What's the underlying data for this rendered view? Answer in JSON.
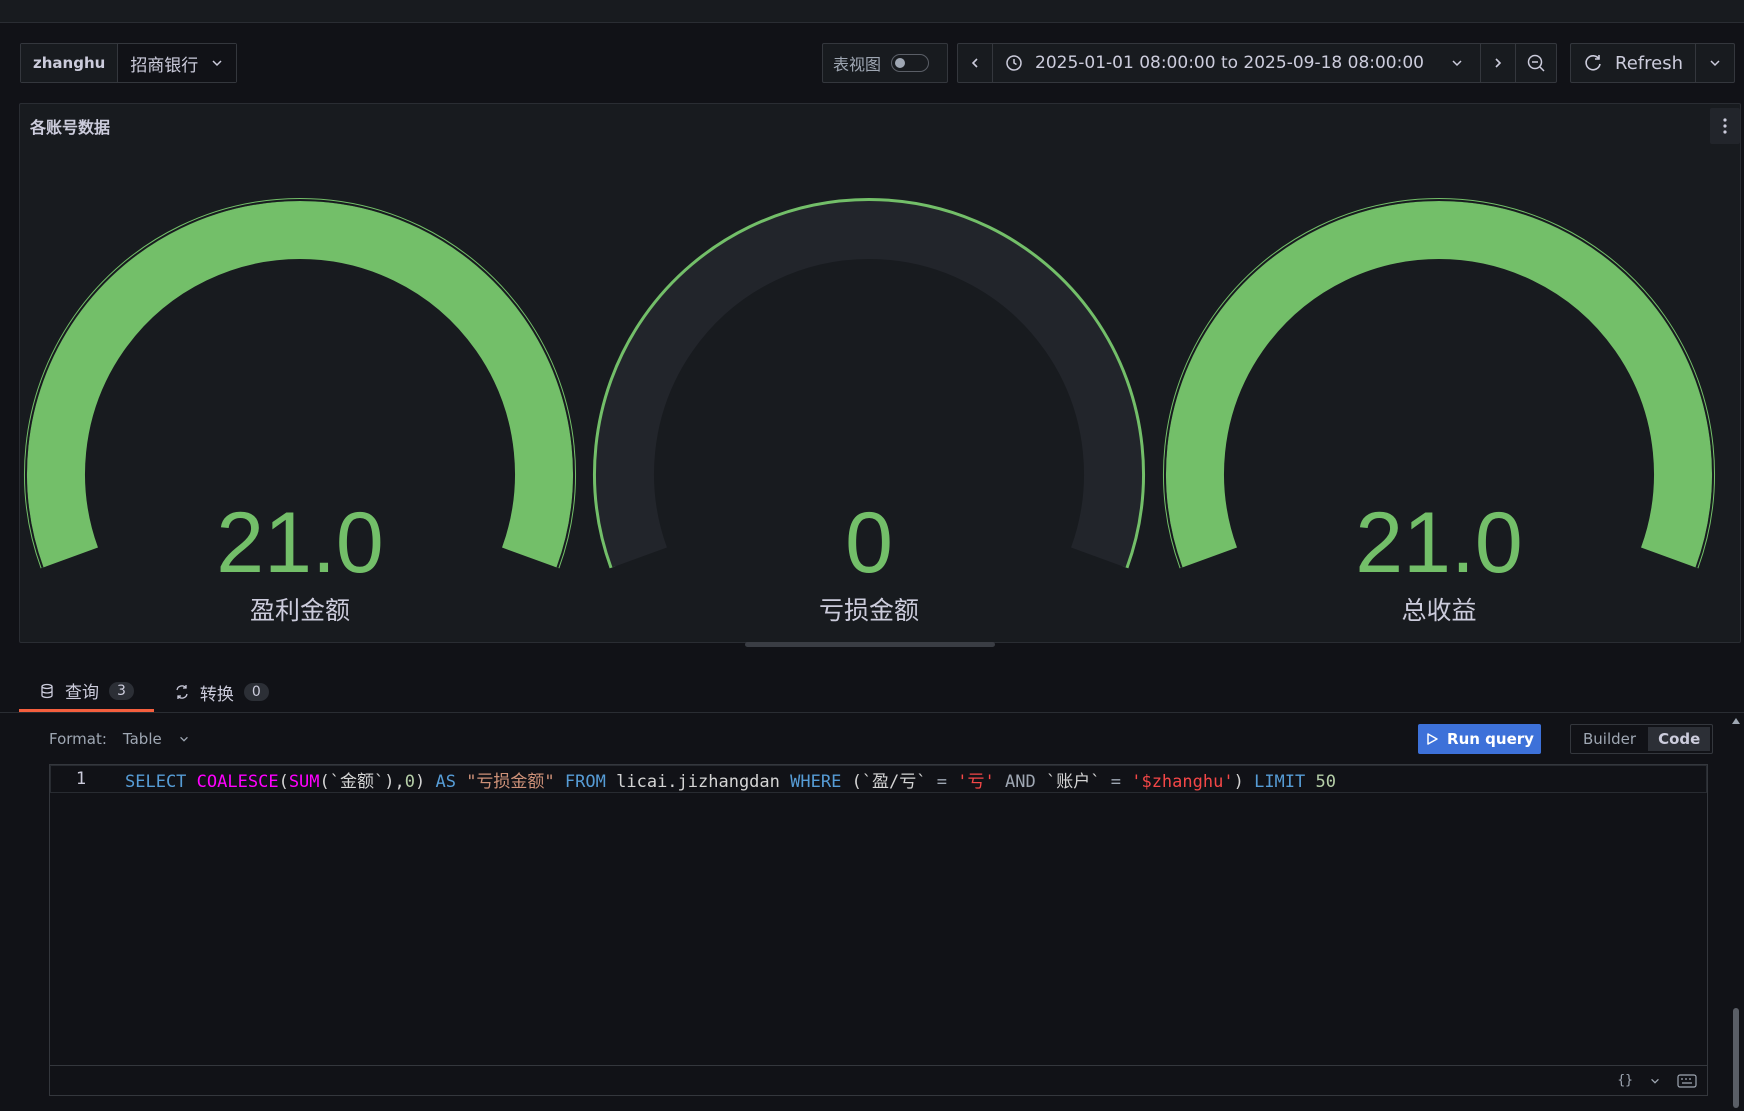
{
  "variables": {
    "label": "zhanghu",
    "value": "招商银行"
  },
  "toolbar": {
    "table_view_label": "表视图",
    "time_range": "2025-01-01 08:00:00 to 2025-09-18 08:00:00",
    "refresh_label": "Refresh"
  },
  "panel": {
    "title": "各账号数据",
    "gauges": [
      {
        "label": "盈利金额",
        "display": "21.0",
        "value": 21.0,
        "fill_fraction": 1.0
      },
      {
        "label": "亏损金额",
        "display": "0",
        "value": 0,
        "fill_fraction": 0.0
      },
      {
        "label": "总收益",
        "display": "21.0",
        "value": 21.0,
        "fill_fraction": 1.0
      }
    ]
  },
  "colors": {
    "gauge_green": "#73bf69",
    "gauge_track": "#22252b",
    "run_button": "#3d71d9",
    "active_tab": "#f55f3e"
  },
  "tabs": [
    {
      "label": "查询",
      "count": "3"
    },
    {
      "label": "转换",
      "count": "0"
    }
  ],
  "query": {
    "format_label": "Format:",
    "format_value": "Table",
    "run_label": "Run query",
    "mode_builder": "Builder",
    "mode_code": "Code",
    "line_number": "1",
    "tokens": {
      "t1": "SELECT",
      "t2": "COALESCE",
      "t3": "(",
      "t4": "SUM",
      "t5": "(`金额`),",
      "t6": "0",
      "t7": ") ",
      "t8": "AS",
      "t9": "\"亏损金额\"",
      "t10": "FROM",
      "t11": "licai.jizhangdan",
      "t12": "WHERE",
      "t13": "(`盈/亏`",
      "t14": "=",
      "t15": "'亏'",
      "t16": "AND",
      "t17": "`账户`",
      "t18": "=",
      "t19": "'$zhanghu'",
      "t20": ")",
      "t21": "LIMIT",
      "t22": "50"
    },
    "footer_braces": "{}"
  }
}
